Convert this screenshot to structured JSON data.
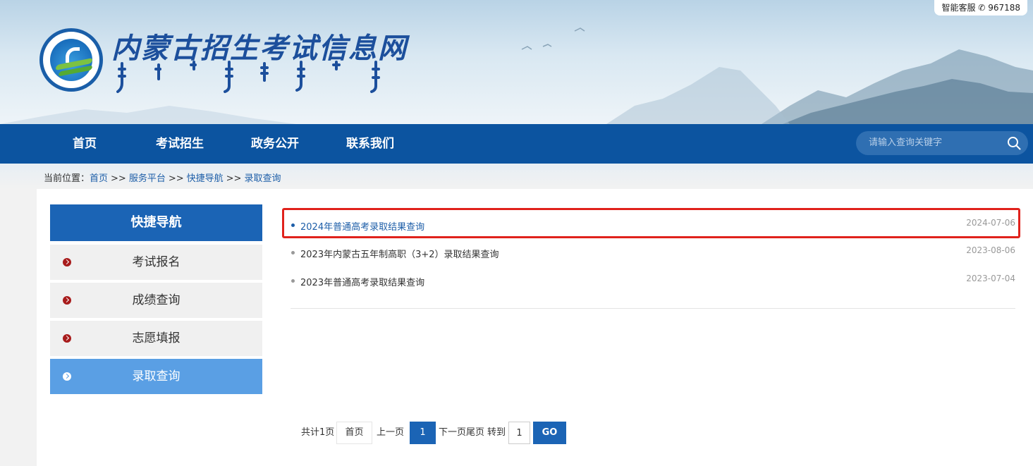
{
  "header": {
    "hotline_label": "智能客服",
    "hotline_number": "967188",
    "site_title": "内蒙古招生考试信息网"
  },
  "nav": {
    "items": [
      {
        "label": "首页"
      },
      {
        "label": "考试招生"
      },
      {
        "label": "政务公开"
      },
      {
        "label": "联系我们"
      }
    ],
    "search_placeholder": "请输入查询关键字"
  },
  "breadcrumb": {
    "prefix": "当前位置：",
    "items": [
      "首页",
      "服务平台",
      "快捷导航",
      "录取查询"
    ],
    "separator": ">>"
  },
  "sidebar": {
    "title": "快捷导航",
    "items": [
      {
        "label": "考试报名",
        "active": false
      },
      {
        "label": "成绩查询",
        "active": false
      },
      {
        "label": "志愿填报",
        "active": false
      },
      {
        "label": "录取查询",
        "active": true
      }
    ]
  },
  "list": {
    "items": [
      {
        "title": "2024年普通高考录取结果查询",
        "date": "2024-07-06",
        "highlighted": true
      },
      {
        "title": "2023年内蒙古五年制高职（3+2）录取结果查询",
        "date": "2023-08-06",
        "highlighted": false
      },
      {
        "title": "2023年普通高考录取结果查询",
        "date": "2023-07-04",
        "highlighted": false
      }
    ]
  },
  "pagination": {
    "total_text": "共计1页",
    "first": "首页",
    "prev": "上一页",
    "current": "1",
    "next_last": "下一页尾页",
    "goto_label": "转到",
    "goto_value": "1",
    "go": "GO"
  },
  "colors": {
    "nav_bg": "#0c54a0",
    "sidebar_title_bg": "#1b64b5",
    "sidebar_active_bg": "#5a9fe4",
    "highlight_border": "#e0221c",
    "link_blue": "#1d5ea8"
  }
}
